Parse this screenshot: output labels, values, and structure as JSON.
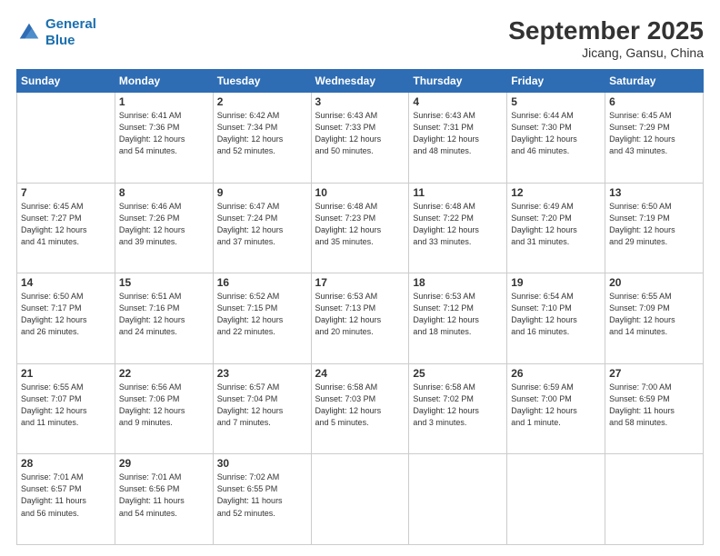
{
  "header": {
    "logo_line1": "General",
    "logo_line2": "Blue",
    "title": "September 2025",
    "subtitle": "Jicang, Gansu, China"
  },
  "days_of_week": [
    "Sunday",
    "Monday",
    "Tuesday",
    "Wednesday",
    "Thursday",
    "Friday",
    "Saturday"
  ],
  "weeks": [
    [
      {
        "day": "",
        "info": ""
      },
      {
        "day": "1",
        "info": "Sunrise: 6:41 AM\nSunset: 7:36 PM\nDaylight: 12 hours\nand 54 minutes."
      },
      {
        "day": "2",
        "info": "Sunrise: 6:42 AM\nSunset: 7:34 PM\nDaylight: 12 hours\nand 52 minutes."
      },
      {
        "day": "3",
        "info": "Sunrise: 6:43 AM\nSunset: 7:33 PM\nDaylight: 12 hours\nand 50 minutes."
      },
      {
        "day": "4",
        "info": "Sunrise: 6:43 AM\nSunset: 7:31 PM\nDaylight: 12 hours\nand 48 minutes."
      },
      {
        "day": "5",
        "info": "Sunrise: 6:44 AM\nSunset: 7:30 PM\nDaylight: 12 hours\nand 46 minutes."
      },
      {
        "day": "6",
        "info": "Sunrise: 6:45 AM\nSunset: 7:29 PM\nDaylight: 12 hours\nand 43 minutes."
      }
    ],
    [
      {
        "day": "7",
        "info": "Sunrise: 6:45 AM\nSunset: 7:27 PM\nDaylight: 12 hours\nand 41 minutes."
      },
      {
        "day": "8",
        "info": "Sunrise: 6:46 AM\nSunset: 7:26 PM\nDaylight: 12 hours\nand 39 minutes."
      },
      {
        "day": "9",
        "info": "Sunrise: 6:47 AM\nSunset: 7:24 PM\nDaylight: 12 hours\nand 37 minutes."
      },
      {
        "day": "10",
        "info": "Sunrise: 6:48 AM\nSunset: 7:23 PM\nDaylight: 12 hours\nand 35 minutes."
      },
      {
        "day": "11",
        "info": "Sunrise: 6:48 AM\nSunset: 7:22 PM\nDaylight: 12 hours\nand 33 minutes."
      },
      {
        "day": "12",
        "info": "Sunrise: 6:49 AM\nSunset: 7:20 PM\nDaylight: 12 hours\nand 31 minutes."
      },
      {
        "day": "13",
        "info": "Sunrise: 6:50 AM\nSunset: 7:19 PM\nDaylight: 12 hours\nand 29 minutes."
      }
    ],
    [
      {
        "day": "14",
        "info": "Sunrise: 6:50 AM\nSunset: 7:17 PM\nDaylight: 12 hours\nand 26 minutes."
      },
      {
        "day": "15",
        "info": "Sunrise: 6:51 AM\nSunset: 7:16 PM\nDaylight: 12 hours\nand 24 minutes."
      },
      {
        "day": "16",
        "info": "Sunrise: 6:52 AM\nSunset: 7:15 PM\nDaylight: 12 hours\nand 22 minutes."
      },
      {
        "day": "17",
        "info": "Sunrise: 6:53 AM\nSunset: 7:13 PM\nDaylight: 12 hours\nand 20 minutes."
      },
      {
        "day": "18",
        "info": "Sunrise: 6:53 AM\nSunset: 7:12 PM\nDaylight: 12 hours\nand 18 minutes."
      },
      {
        "day": "19",
        "info": "Sunrise: 6:54 AM\nSunset: 7:10 PM\nDaylight: 12 hours\nand 16 minutes."
      },
      {
        "day": "20",
        "info": "Sunrise: 6:55 AM\nSunset: 7:09 PM\nDaylight: 12 hours\nand 14 minutes."
      }
    ],
    [
      {
        "day": "21",
        "info": "Sunrise: 6:55 AM\nSunset: 7:07 PM\nDaylight: 12 hours\nand 11 minutes."
      },
      {
        "day": "22",
        "info": "Sunrise: 6:56 AM\nSunset: 7:06 PM\nDaylight: 12 hours\nand 9 minutes."
      },
      {
        "day": "23",
        "info": "Sunrise: 6:57 AM\nSunset: 7:04 PM\nDaylight: 12 hours\nand 7 minutes."
      },
      {
        "day": "24",
        "info": "Sunrise: 6:58 AM\nSunset: 7:03 PM\nDaylight: 12 hours\nand 5 minutes."
      },
      {
        "day": "25",
        "info": "Sunrise: 6:58 AM\nSunset: 7:02 PM\nDaylight: 12 hours\nand 3 minutes."
      },
      {
        "day": "26",
        "info": "Sunrise: 6:59 AM\nSunset: 7:00 PM\nDaylight: 12 hours\nand 1 minute."
      },
      {
        "day": "27",
        "info": "Sunrise: 7:00 AM\nSunset: 6:59 PM\nDaylight: 11 hours\nand 58 minutes."
      }
    ],
    [
      {
        "day": "28",
        "info": "Sunrise: 7:01 AM\nSunset: 6:57 PM\nDaylight: 11 hours\nand 56 minutes."
      },
      {
        "day": "29",
        "info": "Sunrise: 7:01 AM\nSunset: 6:56 PM\nDaylight: 11 hours\nand 54 minutes."
      },
      {
        "day": "30",
        "info": "Sunrise: 7:02 AM\nSunset: 6:55 PM\nDaylight: 11 hours\nand 52 minutes."
      },
      {
        "day": "",
        "info": ""
      },
      {
        "day": "",
        "info": ""
      },
      {
        "day": "",
        "info": ""
      },
      {
        "day": "",
        "info": ""
      }
    ]
  ]
}
